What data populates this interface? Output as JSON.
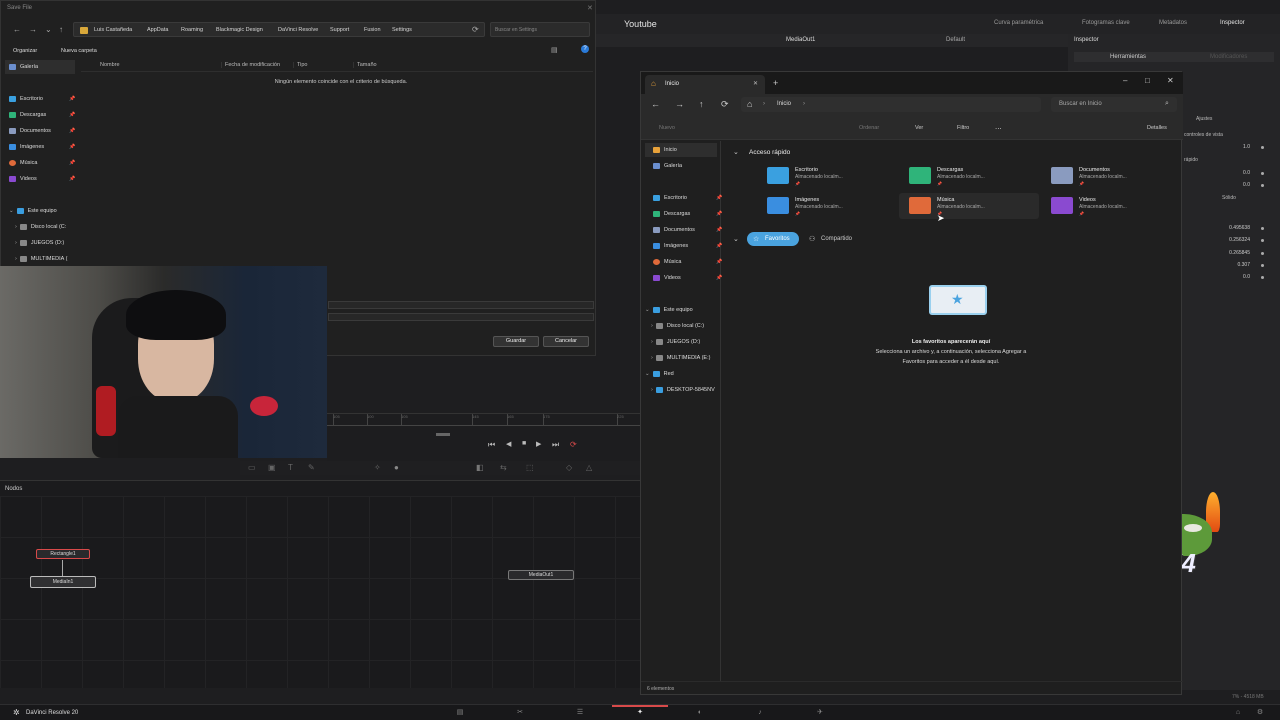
{
  "resolve": {
    "project_title": "Youtube",
    "toolbar_items": [
      "Curva paramétrica",
      "Fotogramas clave",
      "Metadatos",
      "Inspector"
    ],
    "viewer_title": "MediaOut1",
    "viewer_zoom": "Default",
    "inspector_header": "Inspector",
    "inspector_tab": "Herramientas",
    "inspector_tab2": "Modificadores",
    "inspector_labels": [
      "Ajustes",
      "controles de vista",
      "rápido",
      "Sólido"
    ],
    "inspector_values": [
      "1.0",
      "0.0",
      "0.0",
      "0.495638",
      "0.256324",
      "0.265845",
      "0.307",
      "0.0"
    ],
    "ruler_ticks": [
      "105",
      "100",
      "105",
      "145",
      "165",
      "175",
      "225"
    ],
    "nodes_label": "Nodos",
    "nodes": [
      "Rectangle1",
      "MediaIn1",
      "MediaOut1"
    ],
    "app_name": "DaVinci Resolve 20",
    "memory": "7% - 4518 MB",
    "sticker_text": "X4"
  },
  "save_dialog": {
    "title": "Save File",
    "breadcrumb": [
      "Luis Castañeda",
      "AppData",
      "Roaming",
      "Blackmagic Design",
      "DaVinci Resolve",
      "Support",
      "Fusion",
      "Settings"
    ],
    "search_placeholder": "Buscar en Settings",
    "organize": "Organizar",
    "new_folder": "Nueva carpeta",
    "sidebar": [
      {
        "label": "Galería",
        "color": "#6b8fcf",
        "pin": false
      },
      {
        "label": "Escritorio",
        "color": "#3aa0e0",
        "pin": true
      },
      {
        "label": "Descargas",
        "color": "#2fb47a",
        "pin": true
      },
      {
        "label": "Documentos",
        "color": "#8a9bbf",
        "pin": true
      },
      {
        "label": "Imágenes",
        "color": "#3a8ee0",
        "pin": true
      },
      {
        "label": "Música",
        "color": "#e06a3a",
        "pin": true
      },
      {
        "label": "Videos",
        "color": "#8a4ad0",
        "pin": true
      },
      {
        "label": "Este equipo",
        "color": "#3a9ee0",
        "pin": false
      },
      {
        "label": "Disco local (C:",
        "color": "#888888",
        "pin": false
      },
      {
        "label": "JUEGOS (D:)",
        "color": "#888888",
        "pin": false
      },
      {
        "label": "MULTIMEDIA (",
        "color": "#888888",
        "pin": false
      }
    ],
    "columns": [
      "Nombre",
      "Fecha de modificación",
      "Tipo",
      "Tamaño"
    ],
    "empty_message": "Ningún elemento coincide con el criterio de búsqueda.",
    "save_button": "Guardar",
    "cancel_button": "Cancelar"
  },
  "explorer": {
    "tab_title": "Inicio",
    "address": "Inicio",
    "search_placeholder": "Buscar en Inicio",
    "commands": [
      "Nuevo",
      "Ordenar",
      "Ver",
      "Filtro",
      "...",
      "Detalles"
    ],
    "sidebar": [
      {
        "label": "Inicio",
        "color": "#e8a23a",
        "pin": false
      },
      {
        "label": "Galería",
        "color": "#6b8fcf",
        "pin": false
      },
      {
        "label": "Escritorio",
        "color": "#3aa0e0",
        "pin": true
      },
      {
        "label": "Descargas",
        "color": "#2fb47a",
        "pin": true
      },
      {
        "label": "Documentos",
        "color": "#8a9bbf",
        "pin": true
      },
      {
        "label": "Imágenes",
        "color": "#3a8ee0",
        "pin": true
      },
      {
        "label": "Música",
        "color": "#e06a3a",
        "pin": true
      },
      {
        "label": "Videos",
        "color": "#8a4ad0",
        "pin": true
      },
      {
        "label": "Este equipo",
        "color": "#3a9ee0",
        "pin": false
      },
      {
        "label": "Disco local (C:)",
        "color": "#888888",
        "pin": false
      },
      {
        "label": "JUEGOS (D:)",
        "color": "#888888",
        "pin": false
      },
      {
        "label": "MULTIMEDIA (E:)",
        "color": "#888888",
        "pin": false
      },
      {
        "label": "Red",
        "color": "#3a9ee0",
        "pin": false
      },
      {
        "label": "DESKTOP-5845NV",
        "color": "#3a9ee0",
        "pin": false
      }
    ],
    "quick_access_title": "Acceso rápido",
    "quick_access": [
      {
        "name": "Escritorio",
        "sub": "Almacenado localm...",
        "color": "#3aa0e0"
      },
      {
        "name": "Descargas",
        "sub": "Almacenado localm...",
        "color": "#2fb47a"
      },
      {
        "name": "Documentos",
        "sub": "Almacenado localm...",
        "color": "#8a9bbf"
      },
      {
        "name": "Imágenes",
        "sub": "Almacenado localm...",
        "color": "#3a8ee0"
      },
      {
        "name": "Música",
        "sub": "Almacenado localm...",
        "color": "#e06a3a"
      },
      {
        "name": "Videos",
        "sub": "Almacenado localm...",
        "color": "#8a4ad0"
      }
    ],
    "pill_favorites": "Favoritos",
    "pill_shared": "Compartido",
    "fav_title": "Los favoritos aparecerán aquí",
    "fav_line1": "Selecciona un archivo y, a continuación, selecciona Agregar a",
    "fav_line2": "Favoritos para acceder a él desde aquí.",
    "status": "6 elementos"
  },
  "colors": {
    "accent": "#4aa3df",
    "pill_bg": "#4aa3df",
    "node_selected": "#d84a4a"
  }
}
